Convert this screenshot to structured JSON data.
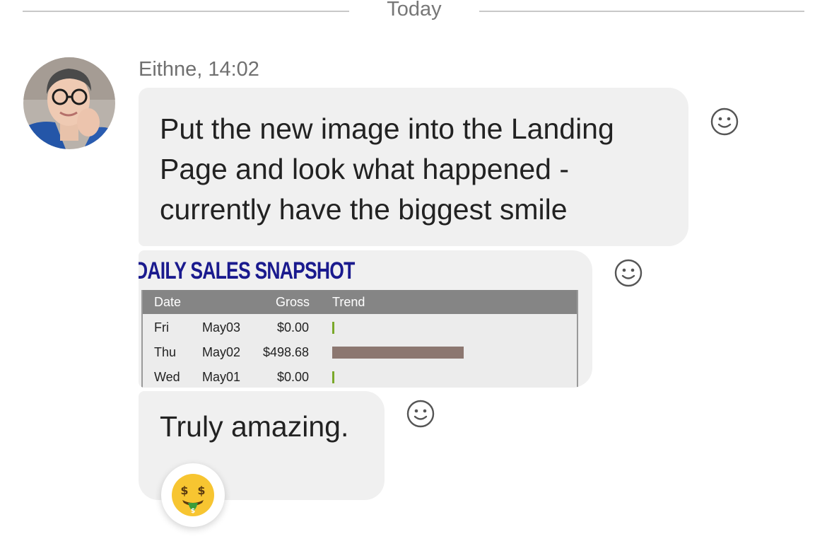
{
  "divider": {
    "label": "Today"
  },
  "message": {
    "author_time": "Eithne, 14:02",
    "text_1": "Put the new image into the Landing Page and look what happened - currently have the biggest smile",
    "text_3": "Truly amazing."
  },
  "snapshot": {
    "title": "DAILY SALES SNAPSHOT",
    "headers": [
      "Date",
      "Gross",
      "Trend"
    ],
    "rows": [
      {
        "day": "Fri",
        "date": "May03",
        "gross": "$0.00",
        "trend": 0.0
      },
      {
        "day": "Thu",
        "date": "May02",
        "gross": "$498.68",
        "trend": 1.0
      },
      {
        "day": "Wed",
        "date": "May01",
        "gross": "$0.00",
        "trend": 0.0
      }
    ]
  },
  "icons": {
    "add_reaction": "smiley-outline-icon",
    "reaction": "money-mouth-face-emoji"
  },
  "colors": {
    "bubble": "#f0f0f0",
    "snapshot_title": "#1a1a8e",
    "bar_full": "#8c7770",
    "bar_zero": "#7aa82a"
  }
}
